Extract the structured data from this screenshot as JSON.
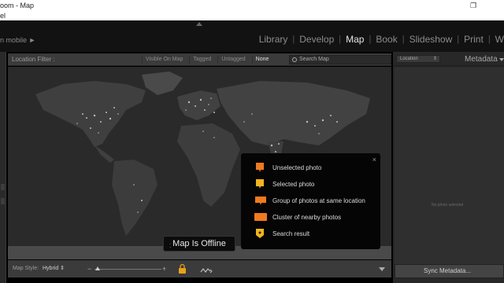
{
  "window": {
    "title": "oom - Map",
    "menu_fragment": "el",
    "controls": [
      "minimize",
      "restore",
      "close"
    ]
  },
  "identity_plate": "n mobile ►",
  "modules": [
    {
      "label": "Library",
      "active": false
    },
    {
      "label": "Develop",
      "active": false
    },
    {
      "label": "Map",
      "active": true
    },
    {
      "label": "Book",
      "active": false
    },
    {
      "label": "Slideshow",
      "active": false
    },
    {
      "label": "Print",
      "active": false
    },
    {
      "label": "W",
      "active": false
    }
  ],
  "location_filter": {
    "label": "Location Filter :",
    "options": [
      {
        "label": "Visible On Map",
        "active": false
      },
      {
        "label": "Tagged",
        "active": false
      },
      {
        "label": "Untagged",
        "active": false
      },
      {
        "label": "None",
        "active": true
      }
    ],
    "search_placeholder": "Search Map"
  },
  "legend": {
    "close_label": "×",
    "items": [
      {
        "label": "Unselected photo",
        "icon": "unselected-photo-marker-icon",
        "color": "#f07a1f"
      },
      {
        "label": "Selected photo",
        "icon": "selected-photo-marker-icon",
        "color": "#f2b51f"
      },
      {
        "label": "Group of photos at same location",
        "icon": "group-photos-marker-icon",
        "color": "#f07a1f"
      },
      {
        "label": "Cluster of nearby photos",
        "icon": "cluster-photos-marker-icon",
        "color": "#f07a1f"
      },
      {
        "label": "Search result",
        "icon": "search-result-marker-icon",
        "color": "#f2b51f"
      }
    ]
  },
  "map_status": "Map Is Offline",
  "toolbar": {
    "map_style_label": "Map Style:",
    "map_style_value": "Hybrid ⇕",
    "zoom_minus": "−",
    "zoom_plus": "+",
    "zoom_level": 0.05
  },
  "right_panel": {
    "location_select": "Location",
    "metadata_title": "Metadata",
    "empty_text": "No photo selected",
    "sync_button": "Sync Metadata..."
  },
  "colors": {
    "accent_orange": "#f07a1f",
    "accent_yellow": "#f2b51f",
    "panel_bg": "#282828"
  }
}
